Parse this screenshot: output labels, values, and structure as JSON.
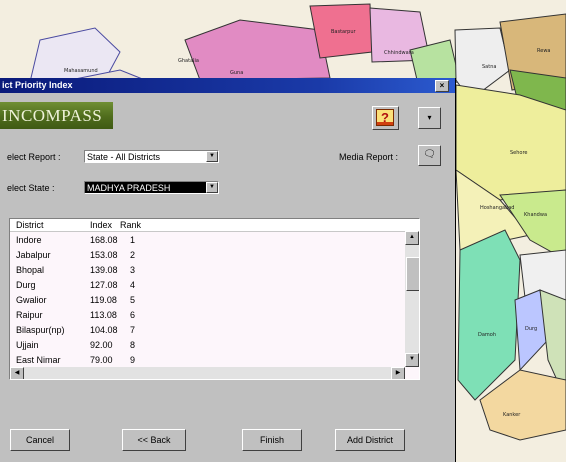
{
  "map": {
    "labels": [
      "Mahasamund",
      "Ghatalia",
      "Bastarpur",
      "Chhindwara",
      "Guna",
      "Satna",
      "Rewa",
      "Sehore",
      "Hoshangabad",
      "Khandwa",
      "Damoh",
      "Durg",
      "Kanker"
    ]
  },
  "dialog": {
    "title": "ict Priority Index",
    "close_label": "×",
    "logo_text": "INCOMPASS",
    "help_icon": "help-question-icon",
    "help_text": "?",
    "dropdown_glyph": "▾",
    "report_label": "elect Report :",
    "report_value": "State - All Districts",
    "state_label": "elect State :",
    "state_value": "MADHYA PRADESH",
    "media_label": "Media Report :",
    "media_icon": "chat-icon",
    "media_glyph": "🗨",
    "select_arrow": "▼"
  },
  "table": {
    "headers": [
      "District",
      "Index",
      "Rank"
    ],
    "rows": [
      [
        "Indore",
        "168.08",
        "1"
      ],
      [
        "Jabalpur",
        "153.08",
        "2"
      ],
      [
        "Bhopal",
        "139.08",
        "3"
      ],
      [
        "Durg",
        "127.08",
        "4"
      ],
      [
        "Gwalior",
        "119.08",
        "5"
      ],
      [
        "Raipur",
        "113.08",
        "6"
      ],
      [
        "Bilaspur(np)",
        "104.08",
        "7"
      ],
      [
        "Ujjain",
        "92.00",
        "8"
      ],
      [
        "East Nimar",
        "79.00",
        "9"
      ]
    ],
    "scroll_up": "▲",
    "scroll_down": "▼",
    "scroll_left": "◀",
    "scroll_right": "▶"
  },
  "buttons": {
    "cancel": "Cancel",
    "back": "<< Back",
    "finish": "Finish",
    "add_district": "Add District"
  }
}
